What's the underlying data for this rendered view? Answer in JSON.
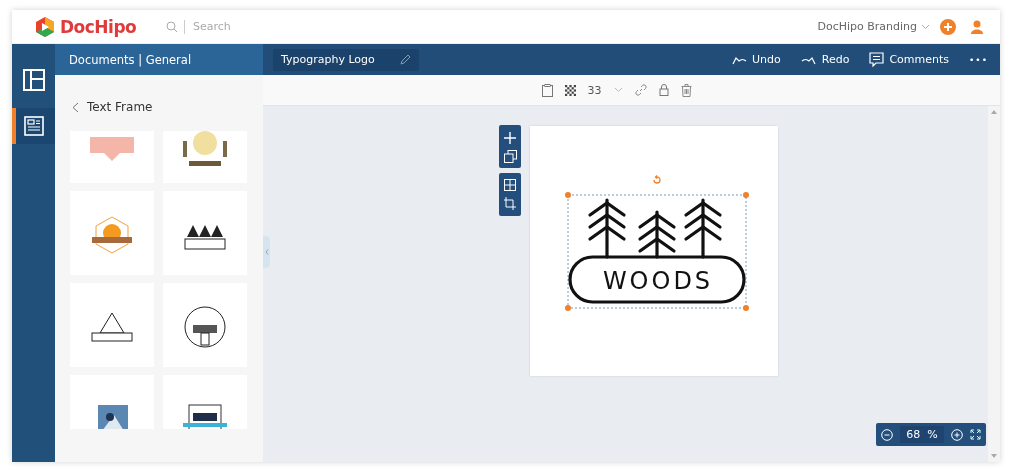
{
  "header": {
    "logo": "DocHipo",
    "search": {
      "placeholder": "Search"
    },
    "workspace": "DocHipo Branding"
  },
  "rail": [
    {
      "kind": "templates",
      "selected": false
    },
    {
      "kind": "text",
      "selected": true
    }
  ],
  "breadcrumb": "Documents | General",
  "document_title": "Typography Logo",
  "actions": [
    {
      "kind": "undo",
      "label": "Undo"
    },
    {
      "kind": "redo",
      "label": "Redo"
    },
    {
      "kind": "comments",
      "label": "Comments"
    },
    {
      "kind": "more",
      "label": "•••"
    }
  ],
  "panel": {
    "title": "Text Frame"
  },
  "toolbar": {
    "transparency": "33"
  },
  "canvas": {
    "text": "WOODS"
  },
  "zoom": {
    "value": "68",
    "unit": "%"
  }
}
